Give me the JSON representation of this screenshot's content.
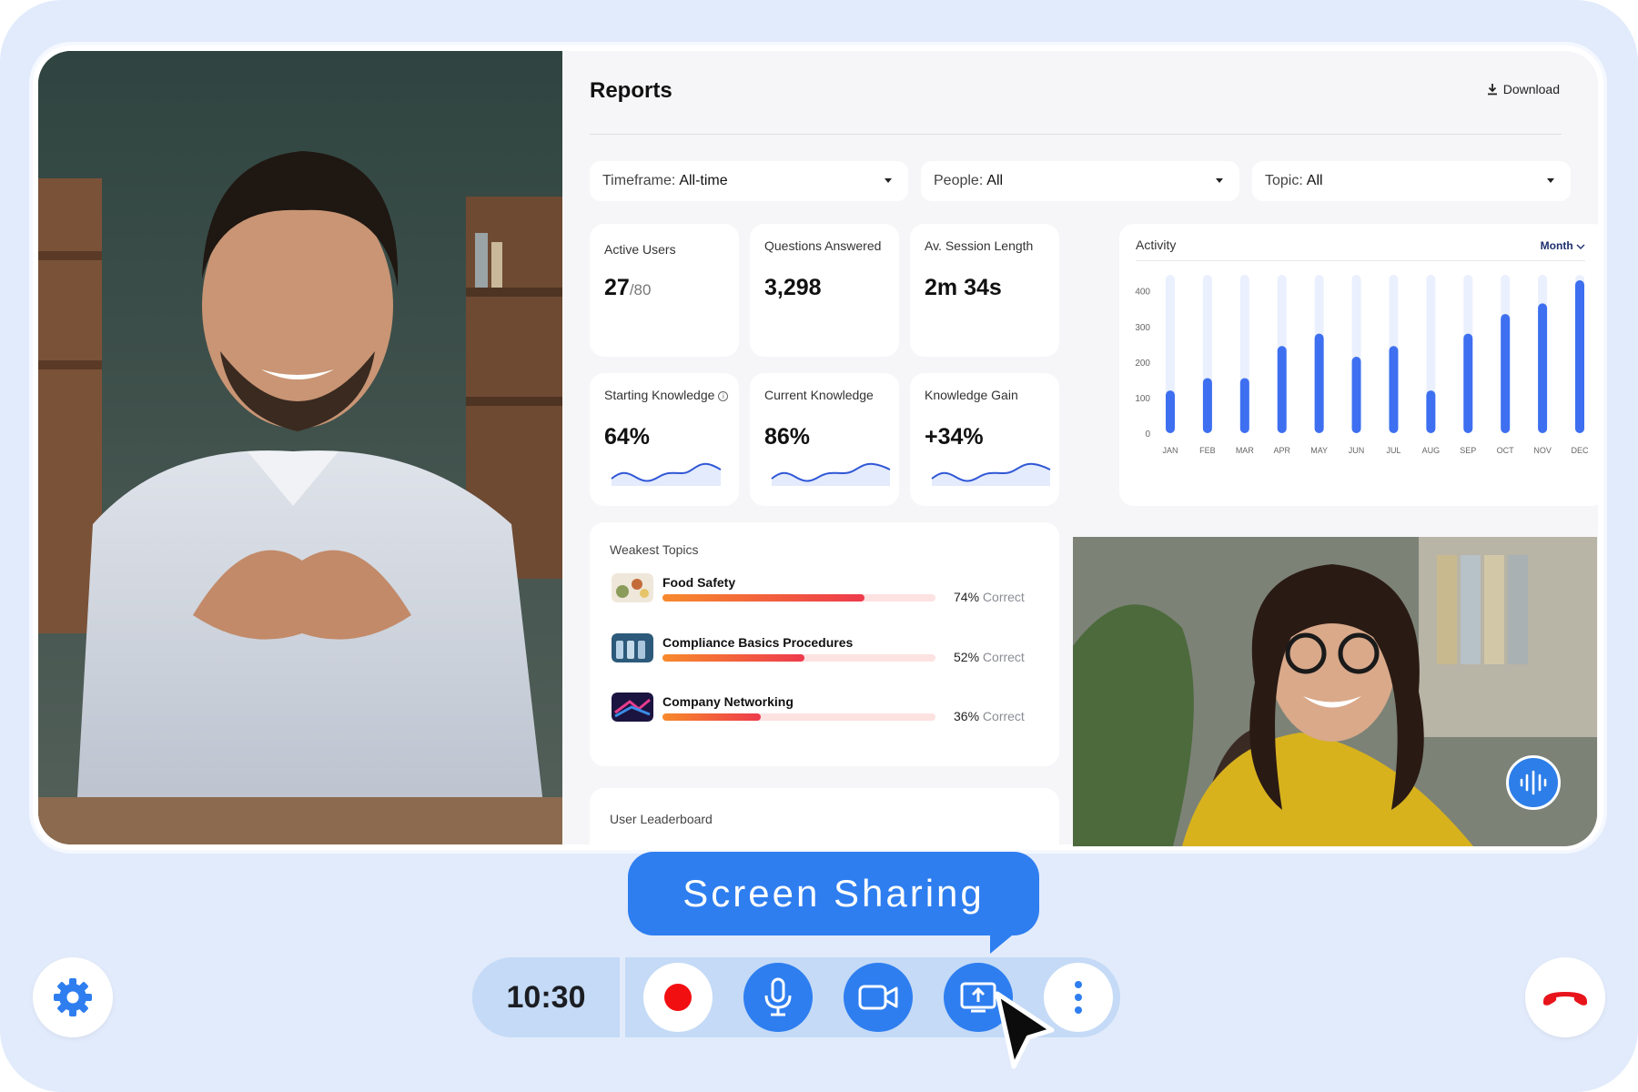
{
  "reports": {
    "title": "Reports",
    "download_label": "Download",
    "filters": [
      {
        "name": "Timeframe:",
        "value": "All-time"
      },
      {
        "name": "People:",
        "value": "All"
      },
      {
        "name": "Topic:",
        "value": "All"
      }
    ],
    "metrics": {
      "active_users": {
        "label": "Active Users",
        "value": "27",
        "total": "/80"
      },
      "questions_answered": {
        "label": "Questions Answered",
        "value": "3,298"
      },
      "session_length": {
        "label": "Av. Session Length",
        "value": "2m 34s"
      },
      "starting_knowledge": {
        "label": "Starting Knowledge",
        "value": "64%",
        "info_glyph": "i"
      },
      "current_knowledge": {
        "label": "Current Knowledge",
        "value": "86%"
      },
      "knowledge_gain": {
        "label": "Knowledge Gain",
        "value": "+34%"
      }
    },
    "activity": {
      "title": "Activity",
      "period": "Month"
    },
    "weakest_topics": {
      "title": "Weakest Topics",
      "items": [
        {
          "name": "Food Safety",
          "percent": "74%",
          "suffix": "Correct",
          "fraction": 0.74
        },
        {
          "name": "Compliance Basics Procedures",
          "percent": "52%",
          "suffix": "Correct",
          "fraction": 0.52
        },
        {
          "name": "Company Networking",
          "percent": "36%",
          "suffix": "Correct",
          "fraction": 0.36
        }
      ]
    },
    "leaderboard": {
      "title": "User Leaderboard"
    }
  },
  "chart_data": {
    "type": "bar",
    "title": "Activity",
    "categories": [
      "JAN",
      "FEB",
      "MAR",
      "APR",
      "MAY",
      "JUN",
      "JUL",
      "AUG",
      "SEP",
      "OCT",
      "NOV",
      "DEC"
    ],
    "values": [
      120,
      155,
      155,
      245,
      280,
      215,
      245,
      120,
      280,
      335,
      365,
      430
    ],
    "yticks": [
      0,
      100,
      200,
      300,
      400
    ],
    "ylim": [
      0,
      430
    ],
    "grid": false,
    "colors": {
      "bar": "#3d6ff0",
      "track": "#eaf0fd"
    }
  },
  "call": {
    "timer": "10:30",
    "bubble_text": "Screen Sharing",
    "icons": [
      "gear-icon",
      "record-icon",
      "microphone-icon",
      "camera-icon",
      "screen-share-icon",
      "more-icon",
      "hang-up-icon",
      "audio-wave-icon",
      "cursor-icon"
    ],
    "colors": {
      "accent": "#2e7ef0",
      "record": "#f20f12",
      "hangup": "#e8141c",
      "toolbar": "#c4daf6"
    }
  }
}
